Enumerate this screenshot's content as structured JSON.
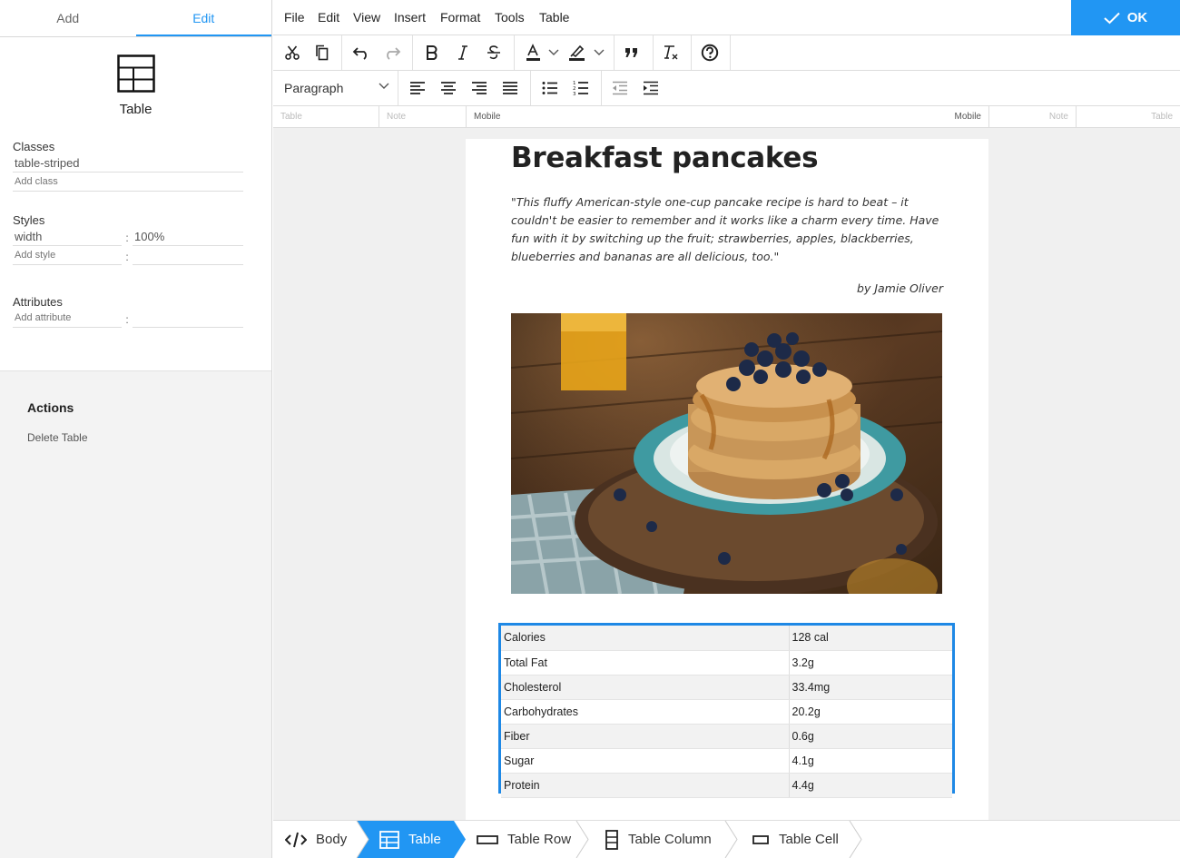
{
  "sidebar": {
    "tabs": [
      "Add",
      "Edit"
    ],
    "element_label": "Table",
    "classes": {
      "title": "Classes",
      "value": "table-striped",
      "placeholder": "Add class"
    },
    "styles": {
      "title": "Styles",
      "key": "width",
      "value": "100%",
      "key_placeholder": "Add style"
    },
    "attributes": {
      "title": "Attributes",
      "key_placeholder": "Add attribute"
    },
    "actions": {
      "title": "Actions",
      "delete_label": "Delete Table"
    }
  },
  "menubar": {
    "items": [
      "File",
      "Edit",
      "View",
      "Insert",
      "Format",
      "Tools",
      "Table"
    ],
    "ok_label": "OK"
  },
  "toolbar": {
    "format_select": "Paragraph"
  },
  "ruler": {
    "labels": [
      "Table",
      "Note",
      "Mobile",
      "Mobile",
      "Note",
      "Table"
    ]
  },
  "document": {
    "title": "Breakfast pancakes",
    "quote": "\"This fluffy American-style one-cup pancake recipe is hard to beat – it couldn't be easier to remember and it works like a charm every time. Have fun with it by switching up the fruit; strawberries, apples, blackberries, blueberries and bananas are all delicious, too.\"",
    "byline": "by Jamie Oliver",
    "nutrition": [
      [
        "Calories",
        "128 cal"
      ],
      [
        "Total Fat",
        "3.2g"
      ],
      [
        "Cholesterol",
        "33.4mg"
      ],
      [
        "Carbohydrates",
        "20.2g"
      ],
      [
        "Fiber",
        "0.6g"
      ],
      [
        "Sugar",
        "4.1g"
      ],
      [
        "Protein",
        "4.4g"
      ]
    ]
  },
  "breadcrumbs": [
    "Body",
    "Table",
    "Table Row",
    "Table Column",
    "Table Cell"
  ],
  "colors": {
    "accent": "#2196f3",
    "selection": "#1e88e5"
  }
}
